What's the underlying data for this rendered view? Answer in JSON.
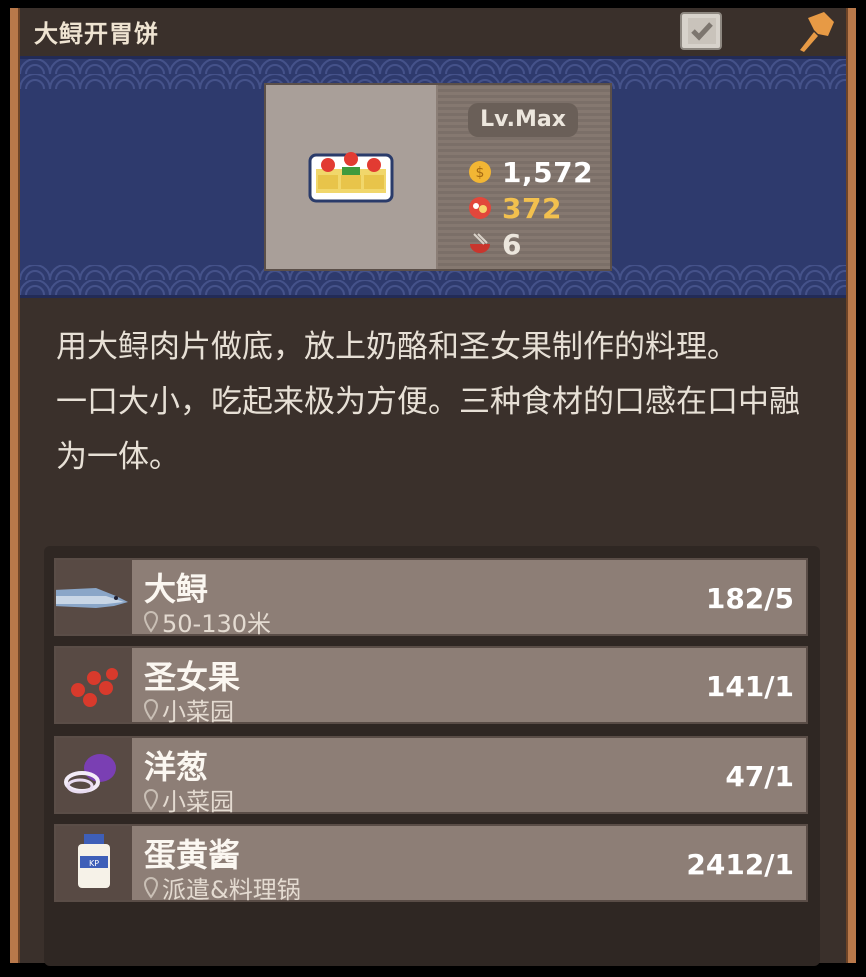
{
  "header": {
    "title": "大鲟开胃饼",
    "check_icon": "check-icon",
    "pin_icon": "pin-icon"
  },
  "item": {
    "image_icon": "dish-icon",
    "level": "Lv.Max",
    "price": "1,572",
    "taste": "372",
    "servings": "6"
  },
  "description": [
    "用大鲟肉片做底，放上奶酪和圣女果制作的料理。",
    "一口大小，吃起来极为方便。三种食材的口感在口中融为一体。"
  ],
  "ingredients": [
    {
      "name": "大鲟",
      "location": "50-130米",
      "count": "182/5",
      "icon": "fish-icon"
    },
    {
      "name": "圣女果",
      "location": "小菜园",
      "count": "141/1",
      "icon": "tomato-icon"
    },
    {
      "name": "洋葱",
      "location": "小菜园",
      "count": "47/1",
      "icon": "onion-icon"
    },
    {
      "name": "蛋黄酱",
      "location": "派遣&料理锅",
      "count": "2412/1",
      "icon": "mayo-icon"
    }
  ],
  "colors": {
    "banner": "#2e3a6d",
    "taste": "#f2c04e",
    "rail": "#b8784a"
  }
}
